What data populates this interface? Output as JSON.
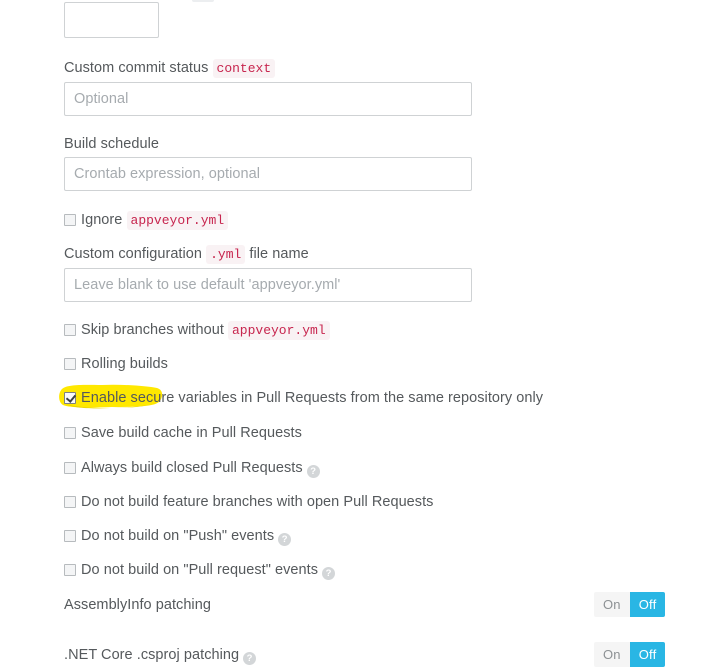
{
  "form": {
    "truncated_field": {
      "value": ""
    },
    "custom_commit_status": {
      "label_prefix": "Custom commit status",
      "code_badge": "context",
      "placeholder": "Optional",
      "value": ""
    },
    "build_schedule": {
      "label": "Build schedule",
      "placeholder": "Crontab expression, optional",
      "value": ""
    },
    "custom_configuration": {
      "label_prefix": "Custom configuration",
      "code_badge": ".yml",
      "label_suffix": "file name",
      "placeholder": "Leave blank to use default 'appveyor.yml'",
      "value": ""
    }
  },
  "checkboxes": [
    {
      "name": "ignore-appveyor-yml",
      "label_prefix": "Ignore",
      "code_badge": "appveyor.yml",
      "label_suffix": "",
      "checked": false,
      "help": false,
      "highlighted": false
    },
    {
      "name": "skip-branches-without-appveyor-yml",
      "label_prefix": "Skip branches without",
      "code_badge": "appveyor.yml",
      "label_suffix": "",
      "checked": false,
      "help": false,
      "highlighted": false
    },
    {
      "name": "rolling-builds",
      "label_prefix": "Rolling builds",
      "code_badge": "",
      "label_suffix": "",
      "checked": false,
      "help": false,
      "highlighted": false
    },
    {
      "name": "enable-secure-variables-in-pull-requests",
      "label_prefix": "Enable secure variables in Pull Requests from the same repository only",
      "code_badge": "",
      "label_suffix": "",
      "checked": true,
      "help": false,
      "highlighted": true
    },
    {
      "name": "save-build-cache-in-pull-requests",
      "label_prefix": "Save build cache in Pull Requests",
      "code_badge": "",
      "label_suffix": "",
      "checked": false,
      "help": false,
      "highlighted": false
    },
    {
      "name": "always-build-closed-pull-requests",
      "label_prefix": "Always build closed Pull Requests",
      "code_badge": "",
      "label_suffix": "",
      "checked": false,
      "help": true,
      "highlighted": false
    },
    {
      "name": "do-not-build-feature-branches-with-open-pull-requests",
      "label_prefix": "Do not build feature branches with open Pull Requests",
      "code_badge": "",
      "label_suffix": "",
      "checked": false,
      "help": false,
      "highlighted": false
    },
    {
      "name": "do-not-build-on-push-events",
      "label_prefix": "Do not build on \"Push\" events",
      "code_badge": "",
      "label_suffix": "",
      "checked": false,
      "help": true,
      "highlighted": false
    },
    {
      "name": "do-not-build-on-pull-request-events",
      "label_prefix": "Do not build on \"Pull request\" events",
      "code_badge": "",
      "label_suffix": "",
      "checked": false,
      "help": true,
      "highlighted": false
    }
  ],
  "toggles": [
    {
      "name": "assemblyinfo-patching",
      "label": "AssemblyInfo patching",
      "help": false,
      "on_label": "On",
      "off_label": "Off",
      "selected": "Off"
    },
    {
      "name": "dotnet-core-csproj-patching",
      "label": ".NET Core .csproj patching",
      "help": true,
      "on_label": "On",
      "off_label": "Off",
      "selected": "Off"
    }
  ],
  "help_icon_glyph": "?",
  "colors": {
    "accent_on": "#29b6e4",
    "code_text": "#c7254e",
    "code_bg": "#f9f2f4",
    "highlight_marker": "#ffe800",
    "text": "#55595c",
    "placeholder": "#a6abaf",
    "border": "#cfd2d4"
  }
}
